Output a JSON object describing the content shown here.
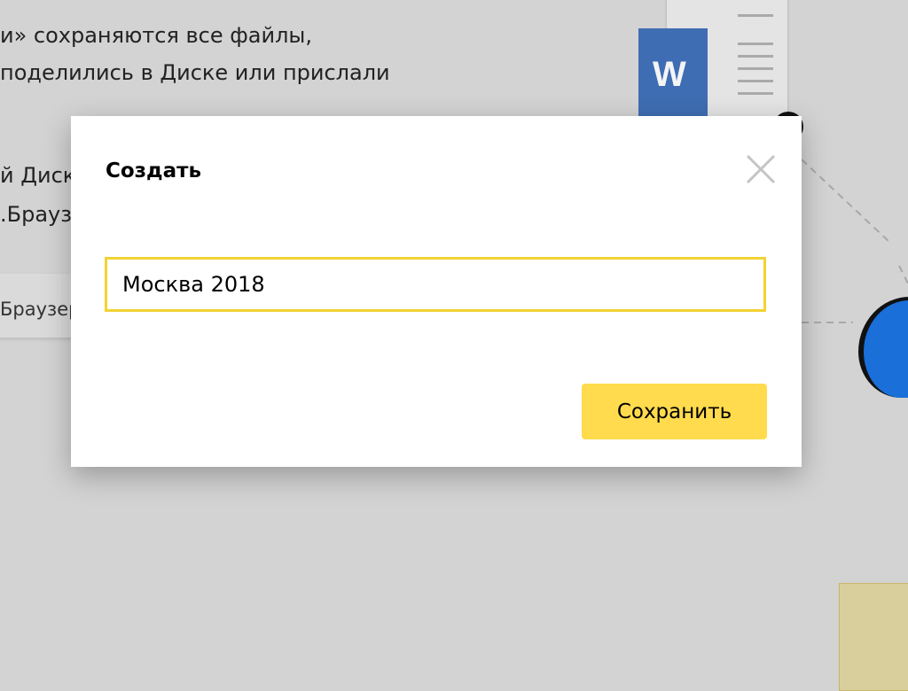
{
  "background": {
    "text_lines": [
      "и» сохраняются все файлы,",
      "поделились в Диске или прислали",
      "й Диск",
      ".Брауз"
    ],
    "partial_button_label": "Браузер",
    "word_icon_letter": "W"
  },
  "dialog": {
    "title": "Создать",
    "name_input_value": "Москва 2018",
    "save_label": "Сохранить"
  },
  "colors": {
    "accent_yellow": "#ffdb4d",
    "input_focus_border": "#f2d334",
    "word_blue": "#3f6db3",
    "overlay_bg": "#d3d3d3"
  }
}
